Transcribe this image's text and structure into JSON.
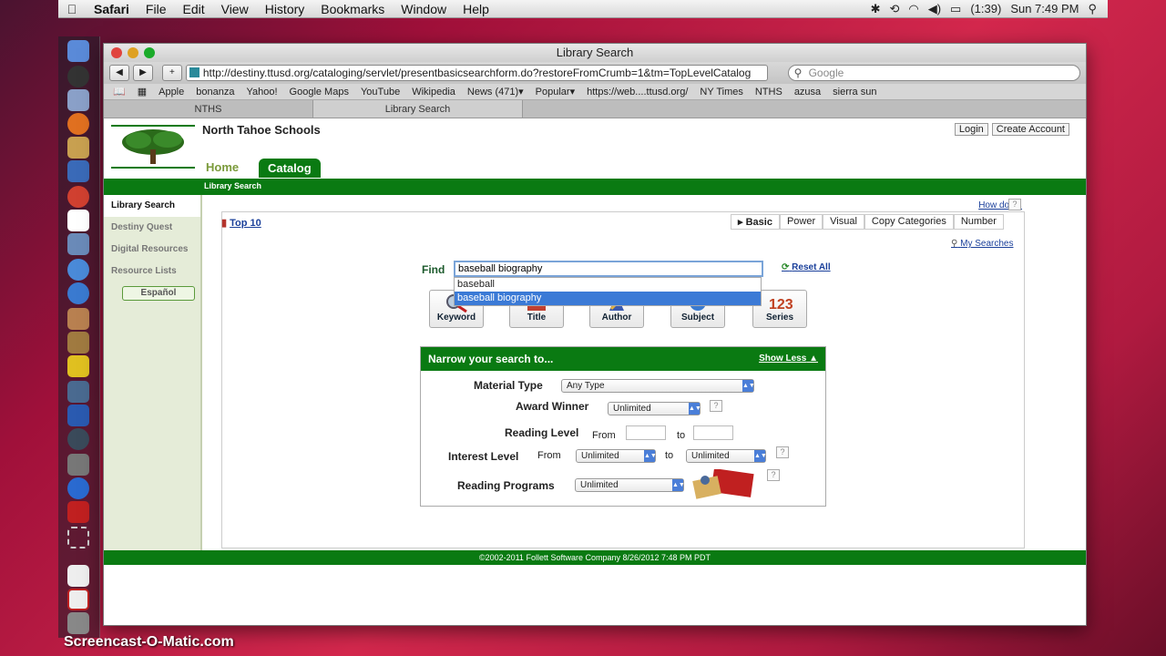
{
  "menubar": {
    "app": "Safari",
    "items": [
      "File",
      "Edit",
      "View",
      "History",
      "Bookmarks",
      "Window",
      "Help"
    ],
    "battery": "(1:39)",
    "clock": "Sun 7:49 PM"
  },
  "browser": {
    "window_title": "Library Search",
    "url": "http://destiny.ttusd.org/cataloging/servlet/presentbasicsearchform.do?restoreFromCrumb=1&tm=TopLevelCatalog",
    "search_placeholder": "Google",
    "bookmarks": [
      "Apple",
      "bonanza",
      "Yahoo!",
      "Google Maps",
      "YouTube",
      "Wikipedia",
      "News (471)▾",
      "Popular▾",
      "https://web....ttusd.org/",
      "NY Times",
      "NTHS",
      "azusa",
      "sierra sun"
    ],
    "tabs": [
      {
        "label": "NTHS",
        "active": false
      },
      {
        "label": "Library Search",
        "active": true
      }
    ]
  },
  "header": {
    "school": "North Tahoe Schools",
    "login": "Login",
    "create_account": "Create Account",
    "nav_home": "Home",
    "nav_catalog": "Catalog",
    "subnav": "Library Search"
  },
  "sidebar": {
    "items": [
      "Library Search",
      "Destiny Quest",
      "Digital Resources",
      "Resource Lists"
    ],
    "espanol": "Español"
  },
  "content": {
    "how_do_i": "How do I...",
    "top10": "Top 10",
    "search_tabs": [
      "Basic",
      "Power",
      "Visual",
      "Copy Categories",
      "Number"
    ],
    "my_searches": "My Searches",
    "find_label": "Find",
    "find_value": "baseball biography",
    "reset_all": "Reset All",
    "suggestions": [
      "baseball",
      "baseball biography"
    ],
    "search_buttons": [
      "Keyword",
      "Title",
      "Author",
      "Subject",
      "Series"
    ]
  },
  "narrow": {
    "title": "Narrow your search to...",
    "show_less": "Show Less",
    "material_type_label": "Material Type",
    "material_type_value": "Any Type",
    "award_label": "Award Winner",
    "award_value": "Unlimited",
    "reading_level_label": "Reading Level",
    "from": "From",
    "to": "to",
    "interest_label": "Interest Level",
    "interest_from_value": "Unlimited",
    "interest_to_value": "Unlimited",
    "programs_label": "Reading Programs",
    "programs_value": "Unlimited"
  },
  "footer": {
    "text": "©2002-2011  Follett Software Company      8/26/2012 7:48 PM PDT"
  },
  "watermark": "Screencast-O-Matic.com"
}
